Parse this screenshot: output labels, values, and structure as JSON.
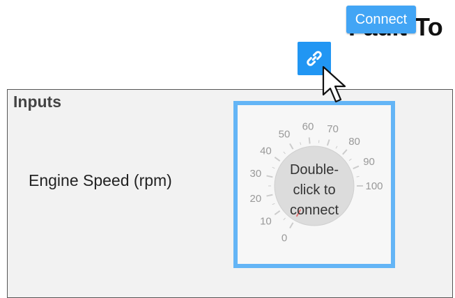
{
  "header": {
    "title": "Fault-To",
    "connect_tooltip": "Connect",
    "link_icon": "link-icon"
  },
  "inputs_panel": {
    "title": "Inputs",
    "engine_speed": {
      "label": "Engine Speed (rpm)",
      "gauge": {
        "min": 0,
        "max": 100,
        "value": 0,
        "tick_labels": [
          "0",
          "10",
          "20",
          "30",
          "40",
          "50",
          "60",
          "70",
          "80",
          "90",
          "100"
        ],
        "placeholder_lines": [
          "Double-",
          "click to",
          "connect"
        ],
        "colors": {
          "frame": "#64b5f6",
          "needle": "#e57373"
        }
      }
    }
  }
}
